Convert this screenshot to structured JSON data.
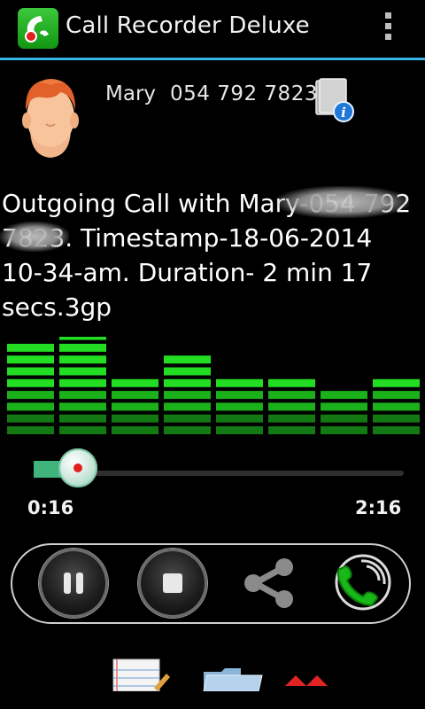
{
  "app": {
    "title": "Call Recorder Deluxe",
    "accent": "#33b5e5",
    "icons": {
      "app": "call-recorder-icon",
      "menu": "overflow-menu-icon"
    }
  },
  "contact": {
    "name": "Mary",
    "number": "054 792 7823",
    "icons": {
      "avatar": "contact-avatar",
      "info": "contact-info-icon"
    }
  },
  "recording": {
    "filename": "Outgoing Call with Mary-054 792 7823. Timestamp-18-06-2014 10-34-am. Duration- 2 min 17 secs.3gp"
  },
  "equalizer": {
    "color": "#22dd22",
    "levels": [
      8,
      9,
      5,
      7,
      5,
      5,
      4,
      5
    ]
  },
  "player": {
    "current_time": "0:16",
    "total_time": "2:16",
    "progress": 0.12,
    "progress_color": "#3fb47c"
  },
  "controls": {
    "icons": [
      "pause-icon",
      "stop-icon",
      "share-icon",
      "call-icon"
    ]
  },
  "toolbar": {
    "icons": [
      "notes-icon",
      "folder-icon",
      "delete-icon"
    ]
  }
}
